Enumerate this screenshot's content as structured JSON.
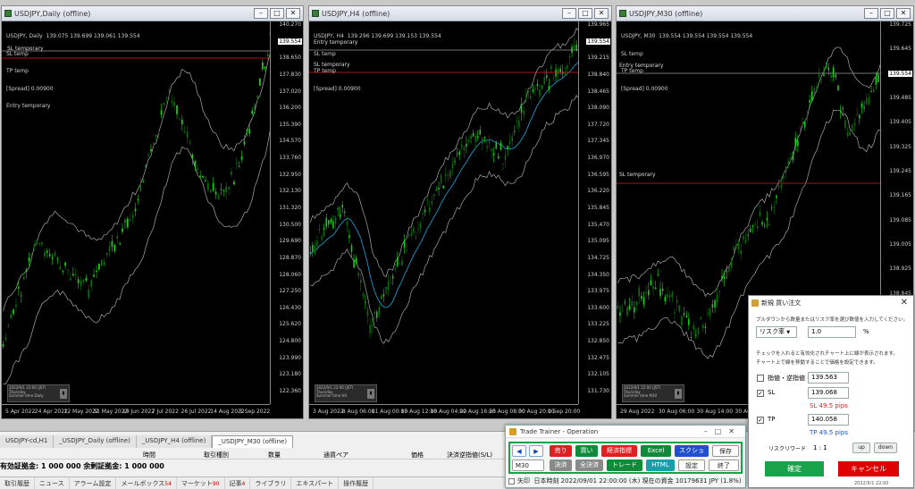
{
  "colors": {
    "candle_bull": "#19d119",
    "candle_bear": "#0b6e0b",
    "sl_line": "#e01e1e",
    "entry_line": "#9a9a9a",
    "band": "#a8a8a8",
    "ma": "#1ea6e0",
    "confirm": "#18a34a",
    "cancel": "#e00000",
    "tp_text": "#1a56d6",
    "sl_text": "#e02020"
  },
  "chart_daily": {
    "title": "USDJPY,Daily (offline)",
    "info": [
      "USDJPY, Daily  139.075 139.699 139.061 139.554",
      "SL temp",
      "TP temp",
      "[Spread] 0.00900",
      "Entry temporary"
    ],
    "sl_label": "SL temporary",
    "cur_price": "139.554",
    "y_labels": [
      "140.270",
      "139.554",
      "138.650",
      "137.830",
      "137.020",
      "136.200",
      "135.390",
      "134.570",
      "133.760",
      "132.950",
      "132.130",
      "131.320",
      "130.500",
      "129.690",
      "128.870",
      "128.060",
      "127.250",
      "126.430",
      "125.620",
      "124.800",
      "123.990",
      "123.180",
      "122.360"
    ],
    "x_labels": [
      "5 Apr 2022",
      "24 Apr 2022",
      "12 May 2022",
      "31 May 2022",
      "19 Jun 2022",
      "7 Jul 2022",
      "26 Jul 2022",
      "14 Aug 2022",
      "1 Sep 2022"
    ],
    "mini": [
      "2022/9/1 22:00 (JST)",
      "Thursday",
      "Summer time  Daily"
    ]
  },
  "chart_h4": {
    "title": "USDJPY,H4 (offline)",
    "info": [
      "USDJPY, H4  139.296 139.699 139.153 139.554",
      "SL temp",
      "TP temp",
      "[Spread] 0.00900"
    ],
    "entry_label": "Entry temporary",
    "sl_label": "SL temporary",
    "cur_price": "139.554",
    "y_labels": [
      "139.965",
      "139.554",
      "139.215",
      "138.840",
      "138.465",
      "138.090",
      "137.720",
      "137.345",
      "136.970",
      "136.595",
      "136.220",
      "135.845",
      "135.470",
      "135.095",
      "134.725",
      "134.350",
      "133.975",
      "133.600",
      "133.225",
      "132.850",
      "132.475",
      "132.105",
      "131.730"
    ],
    "x_labels": [
      "3 Aug 2022",
      "8 Aug 06:00",
      "11 Aug 00:00",
      "15 Aug 12:00",
      "18 Aug 04:00",
      "22 Aug 16:00",
      "25 Aug 08:00",
      "30 Aug 20:00",
      "1 Sep 20:00"
    ],
    "mini": [
      "2022/9/1 22:00 (JST)",
      "Thursday",
      "Summer time  H4"
    ]
  },
  "chart_m30": {
    "title": "USDJPY,M30 (offline)",
    "info": [
      "USDJPY, M30  139.554 139.554 139.554 139.554",
      "SL temp",
      "TP temp",
      "[Spread] 0.00900"
    ],
    "entry_label": "Entry temporary",
    "sl_label": "SL temporary",
    "cur_price": "139.554",
    "y_labels": [
      "139.725",
      "139.645",
      "139.554",
      "139.485",
      "139.405",
      "139.325",
      "139.245",
      "139.165",
      "139.085",
      "139.005",
      "138.925",
      "138.845",
      "138.765",
      "138.685",
      "138.605",
      "138.525"
    ],
    "x_labels": [
      "29 Aug 2022",
      "30 Aug 06:00",
      "30 Aug 14:00",
      "30 Aug 22:00",
      "31 Aug 06:00",
      "31 Aug 14:00",
      "31 Aug 22:00"
    ],
    "mini": [
      "2022/9/1 22:00 (JST)",
      "Thursday",
      "Summer time  M30"
    ]
  },
  "chart_tabs": [
    "USDJPY-cd,H1",
    "_USDJPY_Daily (offline)",
    "_USDJPY_H4 (offline)",
    "_USDJPY_M30 (offline)"
  ],
  "trade_headers": [
    "時間",
    "取引種別",
    "数量",
    "通貨ペア",
    "価格",
    "決済逆指値(S/L)"
  ],
  "balance_text": "有効証拠金: 1 000 000  余剰証拠金: 1 000 000",
  "terminal_tabs": [
    {
      "label": "取引履歴",
      "badge": ""
    },
    {
      "label": "ニュース",
      "badge": ""
    },
    {
      "label": "アラーム設定",
      "badge": ""
    },
    {
      "label": "メールボックス",
      "badge": "54"
    },
    {
      "label": "マーケット",
      "badge": "90"
    },
    {
      "label": "記事",
      "badge": "4"
    },
    {
      "label": "ライブラリ",
      "badge": ""
    },
    {
      "label": "エキスパート",
      "badge": ""
    },
    {
      "label": "操作履歴",
      "badge": ""
    }
  ],
  "trade_trainer": {
    "title": "Trade Trainer - Operation",
    "prev": "◀",
    "next": "▶",
    "sell": "売り",
    "buy": "買い",
    "indicators": "経済指標",
    "excel": "Excel",
    "screenshot": "スクショ",
    "save": "保存",
    "timeframe": "M30",
    "close": "決済",
    "close_all": "全決済",
    "trade": "トレード",
    "html": "HTML",
    "settings": "設定",
    "exit": "終了",
    "arrow_label": "矢印",
    "status": "日本時刻 2022/09/01 22:00:00 (木)   現在の資金 10179631 JPY (1.8%)"
  },
  "order_dialog": {
    "title": "新規 買い注文",
    "instruction": "プルダウンから数量またはリスク率を選び数値を入力してください。",
    "mode": "リスク率",
    "risk_value": "1.0",
    "unit": "%",
    "note1": "チェックを入れると有効化されチャート上に線が表示されます。",
    "note2": "チャート上で線を移動することで価格を設定できます。",
    "limit_label": "指値・逆指値",
    "limit_value": "139.563",
    "sl_label": "SL",
    "sl_value": "139.068",
    "sl_pips": "SL 49.5 pips",
    "tp_label": "TP",
    "tp_value": "140.058",
    "tp_pips": "TP 49.5 pips",
    "rr_label": "リスクリワード",
    "rr_value": "1 : 1",
    "up": "up",
    "down": "down",
    "confirm": "確定",
    "cancel": "キャンセル",
    "footer": "2022/9/1 22:00"
  }
}
